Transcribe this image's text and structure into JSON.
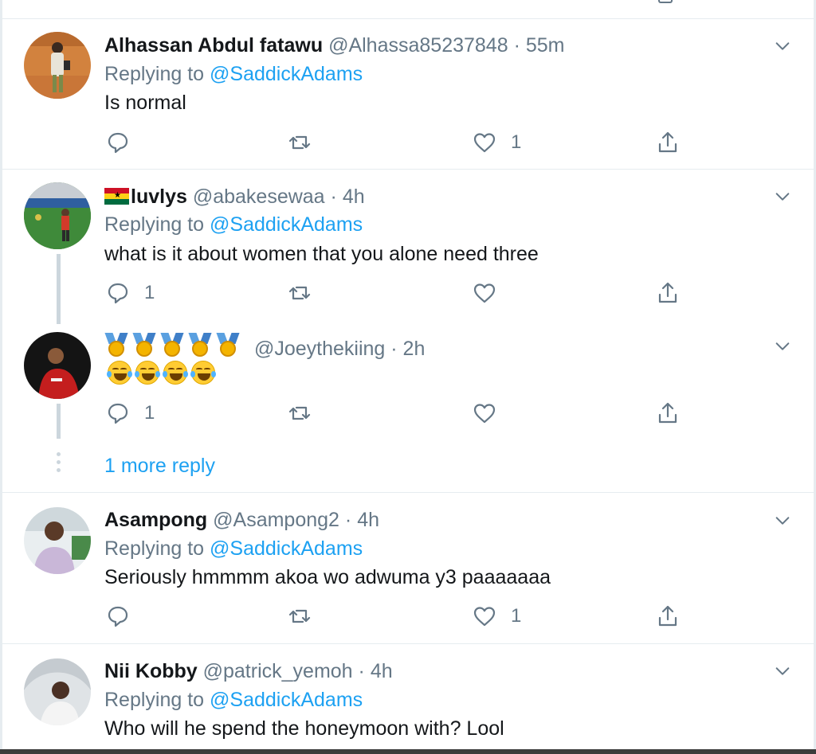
{
  "tweets": [
    {
      "name": "Alhassan Abdul fatawu",
      "handle": "@Alhassa85237848",
      "dot": "·",
      "time": "55m",
      "replying_prefix": "Replying to ",
      "replying_mention": "@SaddickAdams",
      "text": "Is normal",
      "reply_count": "",
      "retweet_count": "",
      "like_count": "1"
    },
    {
      "name": "luvlys",
      "handle": "@abakesewaa",
      "dot": "·",
      "time": "4h",
      "replying_prefix": "Replying to ",
      "replying_mention": "@SaddickAdams",
      "text": "what is it about women that you alone need three",
      "reply_count": "1",
      "retweet_count": "",
      "like_count": ""
    },
    {
      "name": "",
      "handle": "@Joeythekiing",
      "dot": "·",
      "time": "2h",
      "reply_count": "1",
      "retweet_count": "",
      "like_count": ""
    },
    {
      "name": "Asampong",
      "handle": "@Asampong2",
      "dot": "·",
      "time": "4h",
      "replying_prefix": "Replying to ",
      "replying_mention": "@SaddickAdams",
      "text": "Seriously hmmmm akoa wo adwuma y3 paaaaaaa",
      "reply_count": "",
      "retweet_count": "",
      "like_count": "1"
    },
    {
      "name": "Nii Kobby",
      "handle": "@patrick_yemoh",
      "dot": "·",
      "time": "4h",
      "replying_prefix": "Replying to ",
      "replying_mention": "@SaddickAdams",
      "text": "Who will he spend the honeymoon with? Lool"
    }
  ],
  "thread": {
    "more_reply_label": "1 more reply"
  },
  "icons": {
    "reply": "reply-icon",
    "retweet": "retweet-icon",
    "like": "heart-icon",
    "share": "share-icon",
    "caret": "chevron-down-icon",
    "flag": "ghana-flag-icon",
    "medal": "medal-icon",
    "laugh": "laughing-emoji-icon"
  },
  "colors": {
    "link": "#1da1f2",
    "secondary_text": "#657786",
    "primary_text": "#14171a",
    "divider": "#e6ecf0"
  }
}
